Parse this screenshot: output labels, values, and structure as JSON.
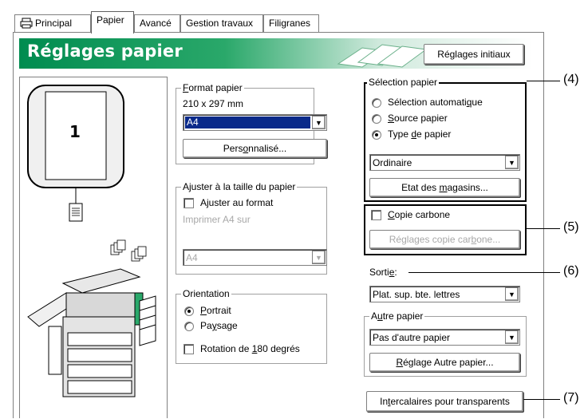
{
  "tabs": [
    {
      "label": "Principal",
      "has_icon": true
    },
    {
      "label": "Papier",
      "active": true
    },
    {
      "label": "Avancé"
    },
    {
      "label": "Gestion travaux"
    },
    {
      "label": "Filigranes"
    }
  ],
  "banner": {
    "title": "Réglages papier",
    "reset_button": "Réglages initiaux"
  },
  "preview": {
    "page_number": "1"
  },
  "format_papier": {
    "label_pre": "",
    "label_u": "F",
    "label_post": "ormat papier",
    "dimensions": "210 x 297 mm",
    "selected": "A4",
    "custom_pre": "Pers",
    "custom_u": "o",
    "custom_post": "nnalisé..."
  },
  "ajuster": {
    "group_label": "Ajuster à la taille du papier",
    "checkbox_label": "Ajuster au format",
    "print_on_label": "Imprimer A4 sur",
    "selected": "A4"
  },
  "orientation": {
    "group_label": "Orientation",
    "portrait_u": "P",
    "portrait_post": "ortrait",
    "paysage_pre": "Pa",
    "paysage_u": "y",
    "paysage_post": "sage",
    "rotation_pre": "Rotation de ",
    "rotation_u": "1",
    "rotation_post": "80 degrés"
  },
  "selection_papier": {
    "group_label": "Sélection papier",
    "auto_pre": "Sélection automati",
    "auto_u": "q",
    "auto_post": "ue",
    "source_u": "S",
    "source_post": "ource papier",
    "type_pre": "Type ",
    "type_u": "d",
    "type_post": "e papier",
    "selected": "Ordinaire",
    "trays_pre": "Etat des ",
    "trays_u": "m",
    "trays_post": "agasins..."
  },
  "copie_carbone": {
    "checkbox_u": "C",
    "checkbox_post": "opie carbone",
    "settings_pre": "Réglages copie car",
    "settings_u": "b",
    "settings_post": "one..."
  },
  "sortie": {
    "label_pre": "Sorti",
    "label_u": "e",
    "label_post": ":",
    "selected": "Plat. sup. bte. lettres"
  },
  "autre_papier": {
    "group_pre": "A",
    "group_u": "u",
    "group_post": "tre papier",
    "selected": "Pas d'autre papier",
    "button_u": "R",
    "button_post": "églage Autre papier..."
  },
  "intercalaires": {
    "pre": "In",
    "u": "t",
    "post": "ercalaires pour transparents"
  },
  "callouts": [
    "(4)",
    "(5)",
    "(6)",
    "(7)"
  ],
  "colors": {
    "banner_green": "#008c50",
    "selection_blue": "#0a2a8a"
  }
}
